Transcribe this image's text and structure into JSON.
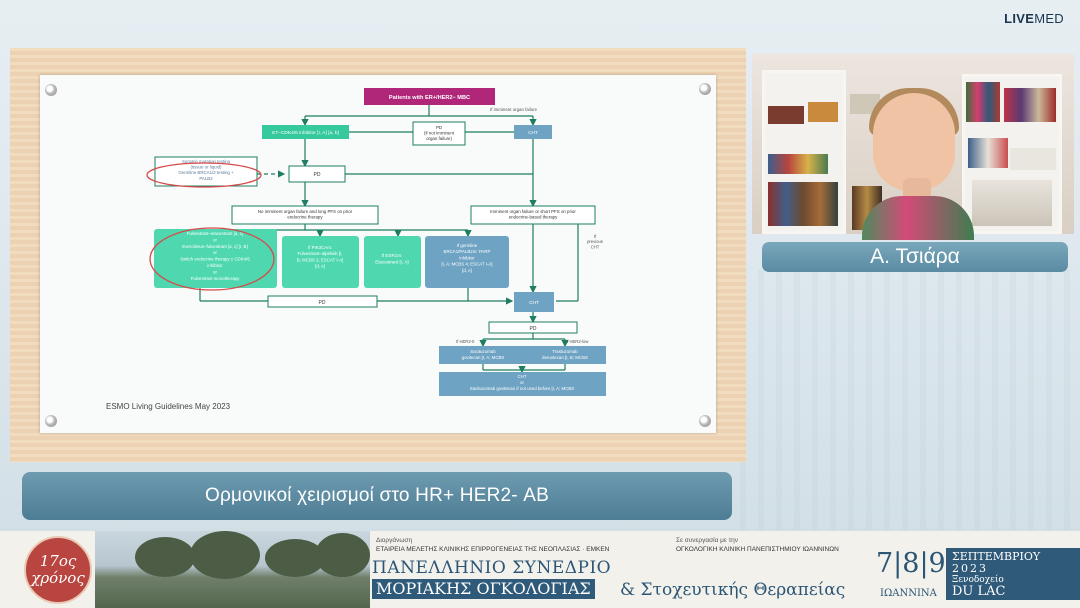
{
  "brand": {
    "live": "LIVE",
    "med": "MED"
  },
  "slide": {
    "source_note": "ESMO Living Guidelines May 2023",
    "flowchart": {
      "top": "Patients with ER+/HER2− MBC",
      "imminent_top": "If imminent organ failure",
      "et_cdk": "ET–CDK4/6 inhibitor [I, A] [a, b]",
      "pd_not_imminent": [
        "PD",
        "(if not imminent",
        "organ failure)"
      ],
      "cht_top": "CHT",
      "somatic": [
        "Somatic mutation testing",
        "(tissue or liquid)",
        "Germline BRCA1/2 testing +",
        "PALB2"
      ],
      "pd_mid": "PD",
      "no_imminent": [
        "No imminent organ failure and long PFS on prior",
        "endocrine therapy"
      ],
      "imminent_short": [
        "Imminent organ failure or short PFS on prior",
        "endocrine-based therapy"
      ],
      "if_previous": [
        "If",
        "previous",
        "CHT"
      ],
      "box1": [
        "Fulvestrant–elacestrant [a, c]",
        "or",
        "Everolimus–fulvestrant [a, c] [I, B]",
        "or",
        "Switch endocrine therapy ± CDK4/6",
        "inhibitor",
        "or",
        "Fulvestrant monotherapy"
      ],
      "box2": [
        "If PIK3CAm:",
        "Fulvestrant–alpelisib [I,",
        "B; MCBS 2; ESCAT I-A]",
        "[d, e]"
      ],
      "box3": [
        "If ESR1m:",
        "Elacestrant [I, A]"
      ],
      "box4": [
        "If germline",
        "BRCA1/PALB2m: PARP",
        "inhibitor",
        "[I, A; MCBS 4; ESCAT I-A]",
        "[d, e]"
      ],
      "pd_bottom": "PD",
      "cht_mid": "CHT",
      "pd_low": "PD",
      "her2_0": "If HER2-0",
      "her2_low": "If HER2-low",
      "sacituzumab": [
        "Sacituzumab",
        "govitecan [I, A; MCBS"
      ],
      "trastuzumab": [
        "Trastuzumab",
        "deruxtecan [I, B; MCBS"
      ],
      "final": [
        "CHT",
        "or",
        "Sacituzumab govitecan if not used before [I, A; MCBS"
      ]
    }
  },
  "caption": "Ορμονικοί χειρισμοί στο HR+ HER2- ΑΒ",
  "speaker_name": "Α. Τσιάρα",
  "footer": {
    "badge_line1": "17ος",
    "badge_line2": "χρόνος",
    "organizer_label": "Διοργάνωση",
    "organizer": "ΕΤΑΙΡΕΙΑ ΜΕΛΕΤΗΣ ΚΛΙΝΙΚΗΣ ΕΠΙΡΡΟΓΕΝΕΙΑΣ ΤΗΣ ΝΕΟΠΛΑΣΙΑΣ · ΕΜΚΕΝ",
    "collab_label": "Σε συνεργασία με την",
    "collab": "ΟΓΚΟΛΟΓΙΚΗ ΚΛΙΝΙΚΗ ΠΑΝΕΠΙΣΤΗΜΙΟΥ ΙΩΑΝΝΙΝΩΝ",
    "title1": "ΠΑΝΕΛΛΗΝΙΟ ΣΥΝΕΔΡΙΟ",
    "title2": "ΜΟΡΙΑΚΗΣ ΟΓΚΟΛΟΓΙΑΣ",
    "title3": "& Στοχευτικής Θεραπείας",
    "dates": "7|8|9",
    "city": "ΙΩΑΝΝΙΝΑ",
    "month": "ΣΕΠΤΕΜΒΡΙΟΥ",
    "year": "2023",
    "hotel": "Ξενοδοχείο",
    "venue": "DU LAC"
  }
}
